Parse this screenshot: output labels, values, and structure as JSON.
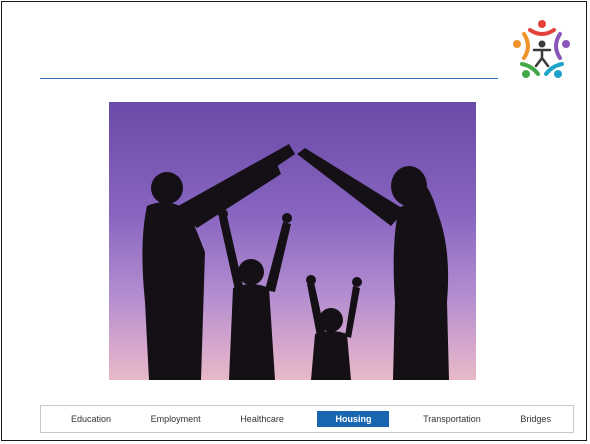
{
  "slide": {
    "title": "",
    "logo_icon": "people-circle-logo-icon",
    "photo_icon": "family-house-silhouette-photo",
    "accent_color": "#1a67b1"
  },
  "nav": {
    "active_index": 3,
    "items": [
      {
        "label": "Education"
      },
      {
        "label": "Employment"
      },
      {
        "label": "Healthcare"
      },
      {
        "label": "Housing"
      },
      {
        "label": "Transportation"
      },
      {
        "label": "Bridges"
      }
    ]
  }
}
